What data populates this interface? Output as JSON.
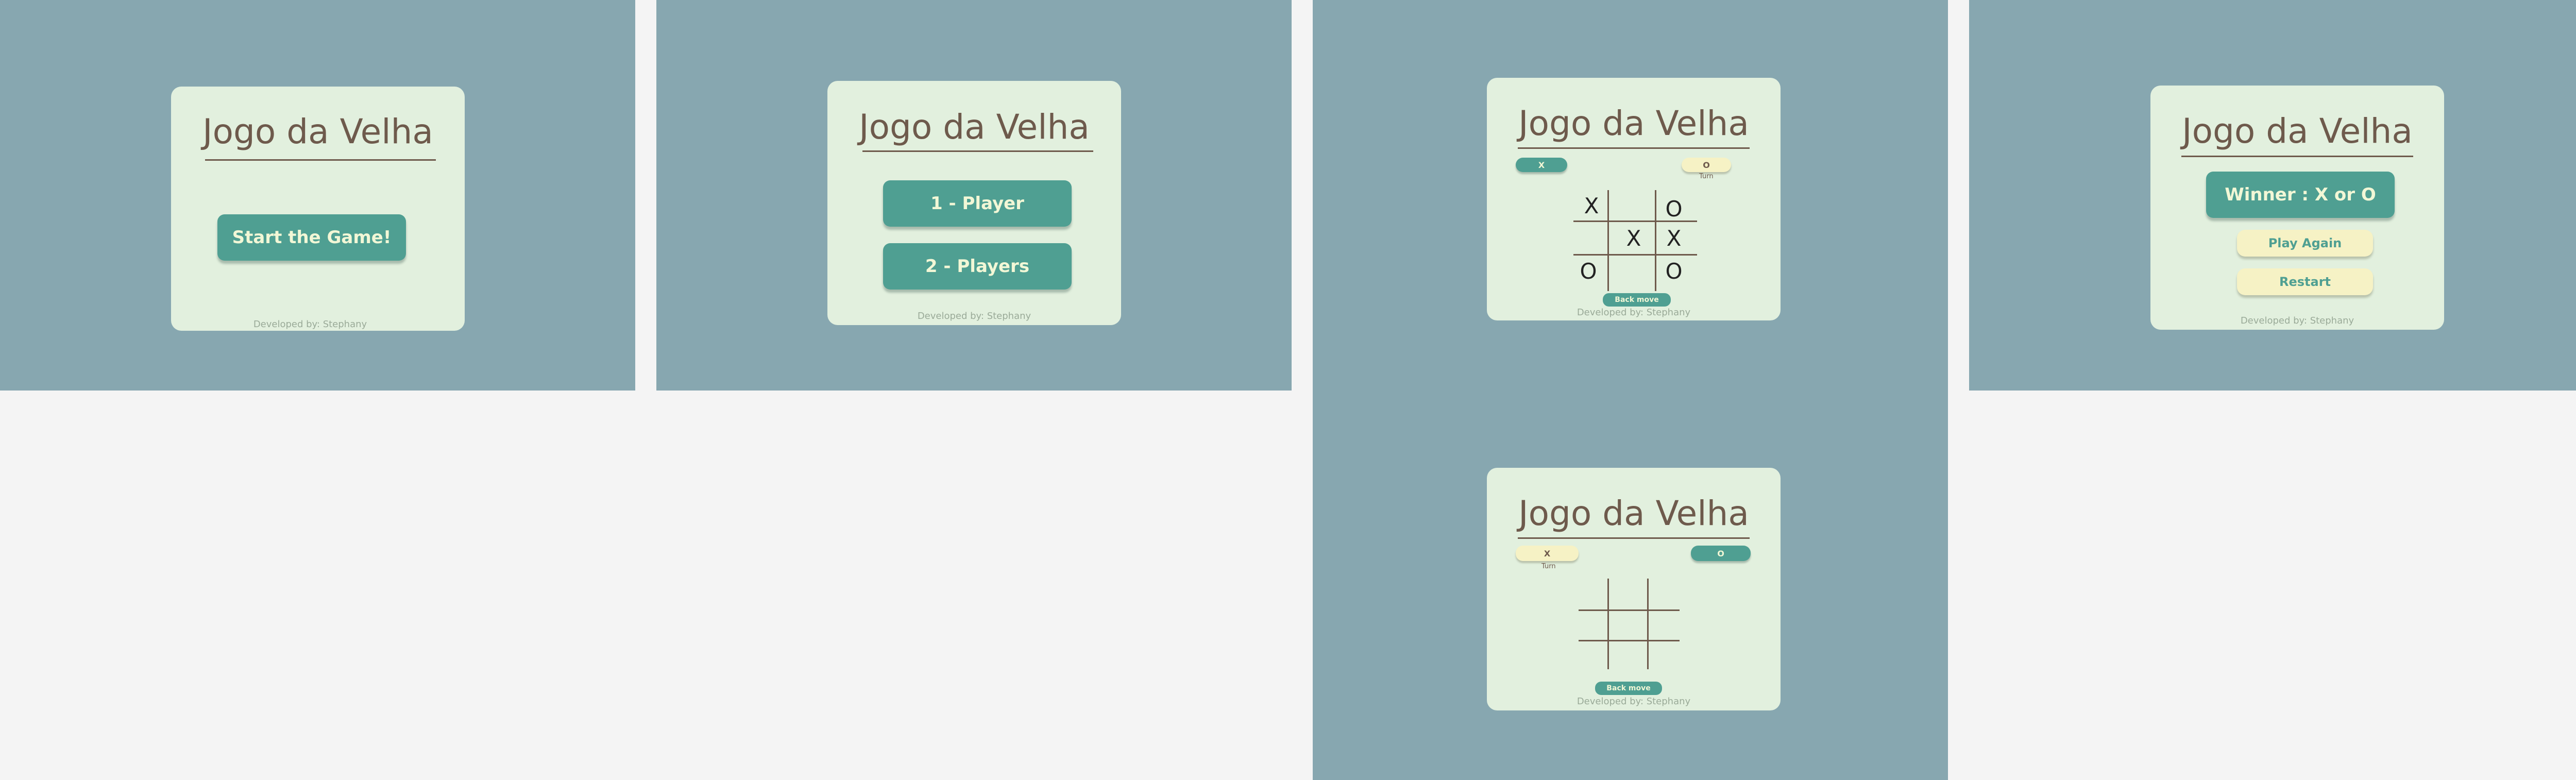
{
  "app_title": "Jogo da Velha",
  "footer": "Developed by: Stephany",
  "screen1": {
    "start_button": "Start the Game!"
  },
  "screen2": {
    "one_player": "1 - Player",
    "two_players": "2 - Players"
  },
  "screen3a": {
    "player_x": "X",
    "player_o": "O",
    "turn_label": "Turn",
    "board": [
      "X",
      "",
      "O",
      "",
      "X",
      "X",
      "O",
      "",
      "O"
    ],
    "back_move": "Back move"
  },
  "screen3b": {
    "player_x": "X",
    "player_o": "O",
    "turn_label": "Turn",
    "board": [
      "",
      "",
      "",
      "",
      "",
      "",
      "",
      "",
      ""
    ],
    "back_move": "Back move"
  },
  "screen4": {
    "winner": "Winner : X  or O",
    "play_again": "Play Again",
    "restart": "Restart"
  }
}
